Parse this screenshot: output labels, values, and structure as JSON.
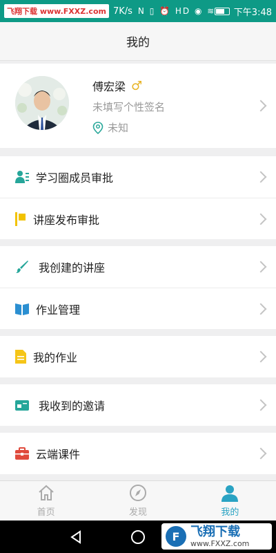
{
  "statusbar": {
    "watermark": "飞翔下载 www.FXXZ.com",
    "speed": "7K/s",
    "icons_text": "N ▯ ⏰ HD ◉ ≋ ⁴ᴳ.ıll ²ᴳ.ıll",
    "time": "下午3:48"
  },
  "header": {
    "title": "我的"
  },
  "profile": {
    "name": "傅宏梁",
    "gender_symbol": "♂",
    "signature": "未填写个性签名",
    "location": "未知"
  },
  "menu": {
    "approval_member": "学习圈成员审批",
    "approval_lecture": "讲座发布审批",
    "my_lectures": "我创建的讲座",
    "homework_manage": "作业管理",
    "my_homework": "我的作业",
    "invites": "我收到的邀请",
    "cloud_courseware": "云端课件"
  },
  "bottomnav": {
    "home": "首页",
    "discover": "发现",
    "mine": "我的"
  },
  "watermark2": {
    "logo": "F",
    "line1": "飞翔下载",
    "line2": "www.FXXZ.com"
  },
  "colors": {
    "accent": "#2aa3c3",
    "statusbar": "#0e9a86",
    "gender": "#e7b324"
  }
}
